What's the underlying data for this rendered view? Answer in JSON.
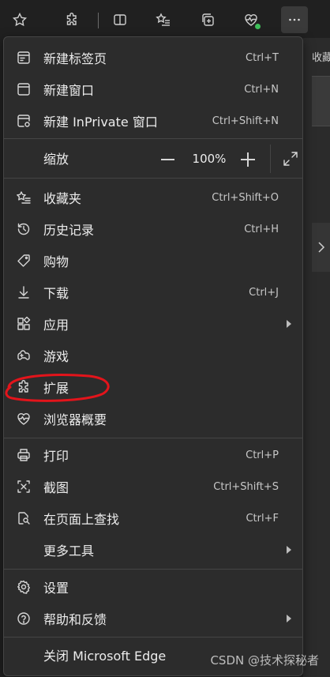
{
  "toolbar": {
    "buttons": [
      "favorites-star-icon",
      "extensions-icon",
      "split-screen-icon",
      "favorites-list-icon",
      "collections-icon",
      "browser-essentials-icon",
      "more-icon"
    ],
    "right_partial_text": "收藏"
  },
  "menu": {
    "items": [
      {
        "label": "新建标签页",
        "shortcut": "Ctrl+T",
        "icon": "new-tab-icon"
      },
      {
        "label": "新建窗口",
        "shortcut": "Ctrl+N",
        "icon": "new-window-icon"
      },
      {
        "label": "新建 InPrivate 窗口",
        "shortcut": "Ctrl+Shift+N",
        "icon": "inprivate-icon"
      },
      {
        "label": "缩放",
        "icon": "none"
      },
      {
        "label": "收藏夹",
        "shortcut": "Ctrl+Shift+O",
        "icon": "favorites-icon"
      },
      {
        "label": "历史记录",
        "shortcut": "Ctrl+H",
        "icon": "history-icon"
      },
      {
        "label": "购物",
        "icon": "shopping-tag-icon"
      },
      {
        "label": "下载",
        "shortcut": "Ctrl+J",
        "icon": "download-icon"
      },
      {
        "label": "应用",
        "icon": "apps-icon",
        "submenu": true
      },
      {
        "label": "游戏",
        "icon": "games-icon"
      },
      {
        "label": "扩展",
        "icon": "extensions-icon"
      },
      {
        "label": "浏览器概要",
        "icon": "browser-essentials-icon"
      },
      {
        "label": "打印",
        "shortcut": "Ctrl+P",
        "icon": "print-icon"
      },
      {
        "label": "截图",
        "shortcut": "Ctrl+Shift+S",
        "icon": "screenshot-icon"
      },
      {
        "label": "在页面上查找",
        "shortcut": "Ctrl+F",
        "icon": "find-icon"
      },
      {
        "label": "更多工具",
        "icon": "none",
        "submenu": true
      },
      {
        "label": "设置",
        "icon": "gear-icon"
      },
      {
        "label": "帮助和反馈",
        "icon": "help-icon",
        "submenu": true
      },
      {
        "label": "关闭 Microsoft Edge",
        "icon": "none"
      }
    ],
    "zoom": {
      "minus": "—",
      "value": "100%",
      "plus": "+"
    }
  },
  "watermark": "CSDN @技术探秘者",
  "colors": {
    "annotation": "#e3141b",
    "background": "#202020",
    "menu": "#2c2c2c"
  }
}
